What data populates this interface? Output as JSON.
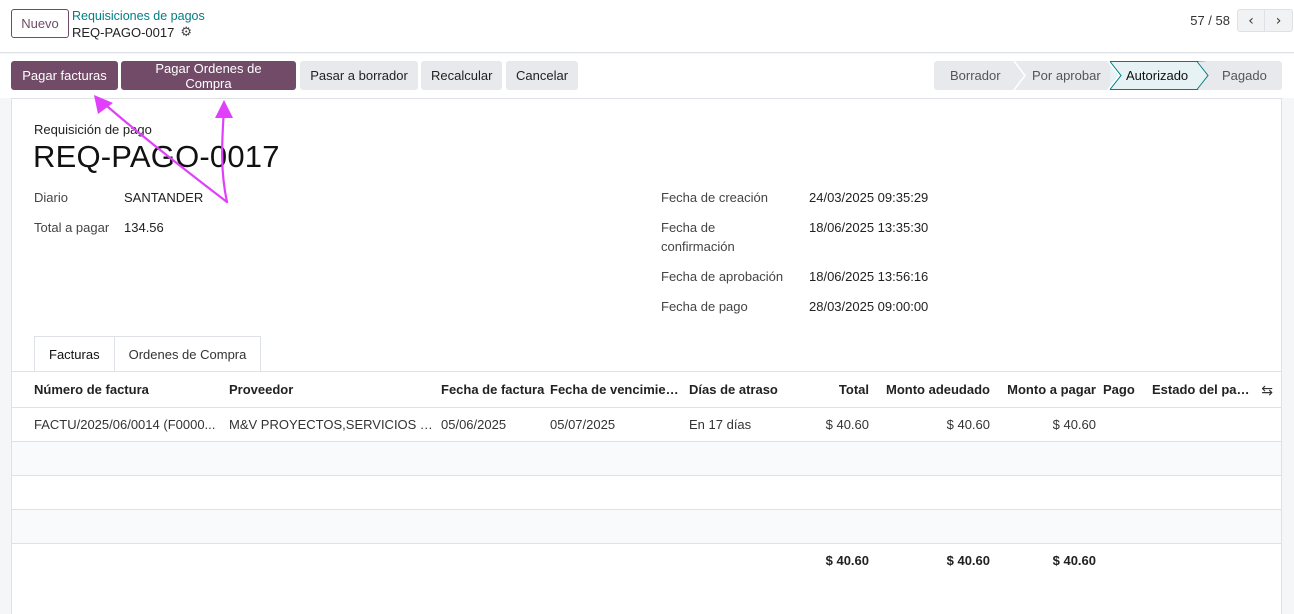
{
  "control_panel": {
    "new_button": "Nuevo",
    "breadcrumb_parent": "Requisiciones de pagos",
    "breadcrumb_current": "REQ-PAGO-0017",
    "pager": "57 / 58"
  },
  "statusbar": {
    "buttons": [
      "Pagar facturas",
      "Pagar Ordenes de Compra",
      "Pasar a borrador",
      "Recalcular",
      "Cancelar"
    ],
    "stages": [
      "Borrador",
      "Por aprobar",
      "Autorizado",
      "Pagado"
    ],
    "active_stage": "Autorizado"
  },
  "form": {
    "doc_label": "Requisición de pago",
    "doc_title": "REQ-PAGO-0017",
    "left_fields": [
      {
        "label": "Diario",
        "value": "SANTANDER"
      },
      {
        "label": "Total a pagar",
        "value": "134.56"
      }
    ],
    "right_fields": [
      {
        "label": "Fecha de creación",
        "value": "24/03/2025 09:35:29"
      },
      {
        "label": "Fecha de",
        "label2": "confirmación",
        "value": "18/06/2025 13:35:30"
      },
      {
        "label": "Fecha de aprobación",
        "value": "18/06/2025 13:56:16"
      },
      {
        "label": "Fecha de pago",
        "value": "28/03/2025 09:00:00"
      }
    ]
  },
  "tabs": [
    "Facturas",
    "Ordenes de Compra"
  ],
  "table": {
    "headers": [
      "Número de factura",
      "Proveedor",
      "Fecha de factura",
      "Fecha de vencimiento",
      "Días de atraso",
      "Total",
      "Monto adeudado",
      "Monto a pagar",
      "Pago",
      "Estado del pago"
    ],
    "rows": [
      [
        "FACTU/2025/06/0014 (F0000...",
        "M&V PROYECTOS,SERVICIOS Y L...",
        "05/06/2025",
        "05/07/2025",
        "En 17 días",
        "$ 40.60",
        "$ 40.60",
        "$ 40.60",
        "",
        ""
      ]
    ],
    "totals": {
      "total": "$ 40.60",
      "adeudado": "$ 40.60",
      "a_pagar": "$ 40.60"
    }
  },
  "icons": {
    "gear": "gear-icon",
    "prev": "chevron-left-icon",
    "next": "chevron-right-icon",
    "optional_columns": "sliders-icon"
  },
  "colors": {
    "primary": "#714b67",
    "link": "#017e84",
    "annotation": "#e040fb"
  }
}
